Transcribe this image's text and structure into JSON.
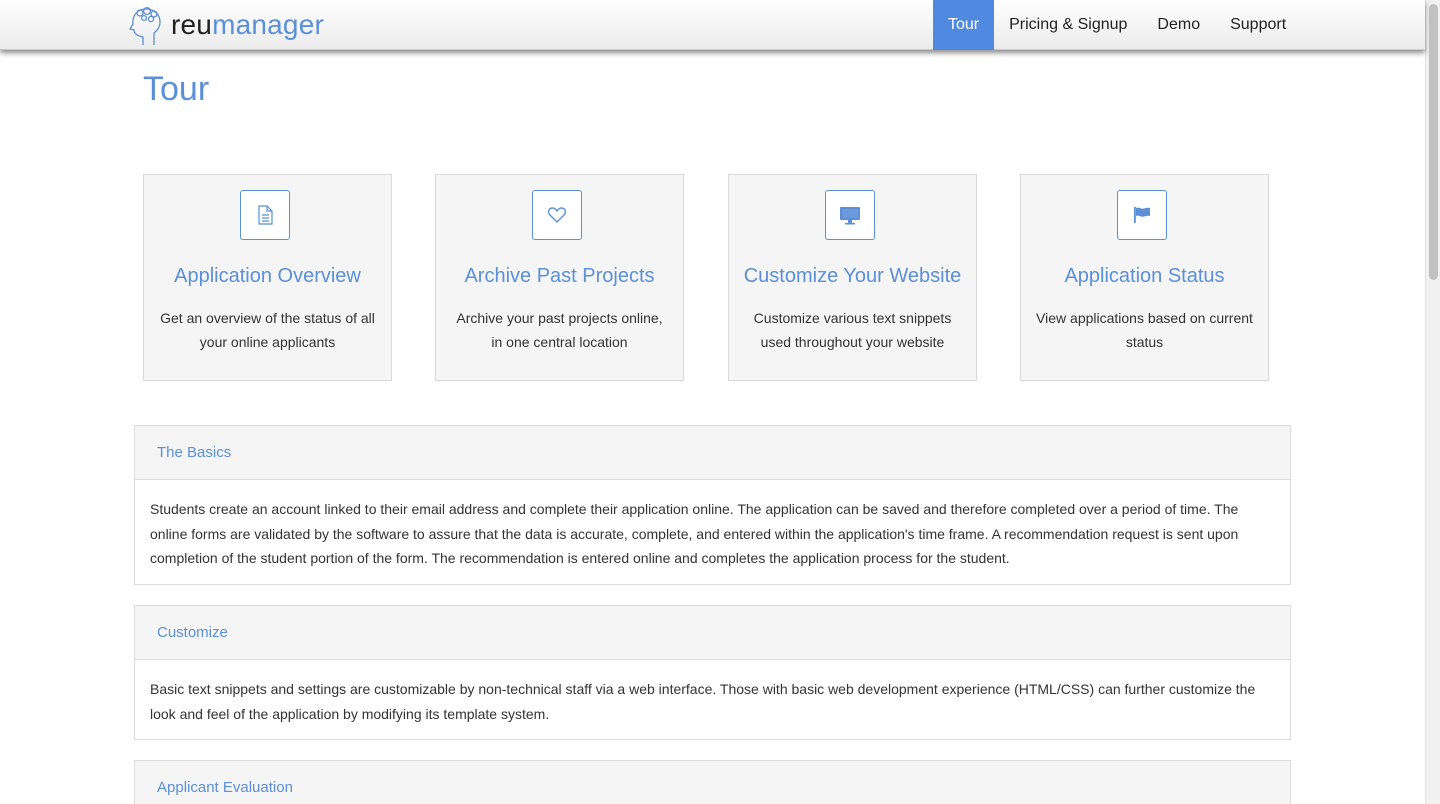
{
  "brand": {
    "part1": "reu",
    "part2": "manager"
  },
  "nav": [
    {
      "label": "Tour",
      "active": true
    },
    {
      "label": "Pricing & Signup",
      "active": false
    },
    {
      "label": "Demo",
      "active": false
    },
    {
      "label": "Support",
      "active": false
    }
  ],
  "page": {
    "title": "Tour"
  },
  "features": [
    {
      "icon": "document-icon",
      "title": "Application Overview",
      "desc": "Get an overview of the status of all your online applicants"
    },
    {
      "icon": "heart-icon",
      "title": "Archive Past Projects",
      "desc": "Archive your past projects online, in one central location"
    },
    {
      "icon": "monitor-icon",
      "title": "Customize Your Website",
      "desc": "Customize various text snippets used throughout your website"
    },
    {
      "icon": "flag-icon",
      "title": "Application Status",
      "desc": "View applications based on current status"
    }
  ],
  "panels": [
    {
      "heading": "The Basics",
      "body": "Students create an account linked to their email address and complete their application online. The application can be saved and therefore completed over a period of time. The online forms are validated by the software to assure that the data is accurate, complete, and entered within the application's time frame. A recommendation request is sent upon completion of the student portion of the form. The recommendation is entered online and completes the application process for the student."
    },
    {
      "heading": "Customize",
      "body": "Basic text snippets and settings are customizable by non-technical staff via a web interface. Those with basic web development experience (HTML/CSS) can further customize the look and feel of the application by modifying its template system."
    },
    {
      "heading": "Applicant Evaluation",
      "body": ""
    }
  ],
  "colors": {
    "accent": "#5b8fd8",
    "nav_active": "#4f8ae0",
    "panel_bg": "#f5f5f5"
  }
}
